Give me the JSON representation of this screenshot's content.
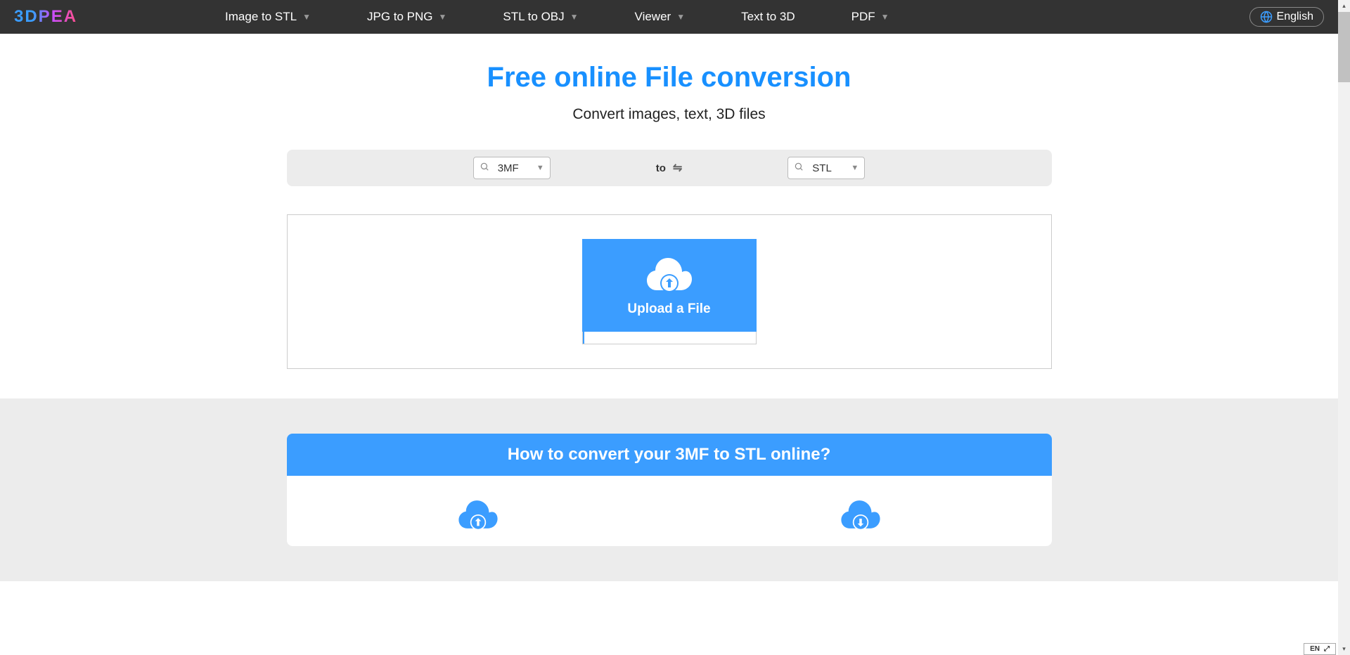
{
  "logo": "3DPEA",
  "nav": [
    {
      "label": "Image to STL",
      "hasChevron": true
    },
    {
      "label": "JPG to PNG",
      "hasChevron": true
    },
    {
      "label": "STL to OBJ",
      "hasChevron": true
    },
    {
      "label": "Viewer",
      "hasChevron": true
    },
    {
      "label": "Text to 3D",
      "hasChevron": false
    },
    {
      "label": "PDF",
      "hasChevron": true
    }
  ],
  "language": "English",
  "hero": {
    "title": "Free online File conversion",
    "subtitle": "Convert images, text, 3D files"
  },
  "converter": {
    "from": "3MF",
    "to_label": "to",
    "to": "STL"
  },
  "upload": {
    "button": "Upload a File"
  },
  "howto": {
    "title": "How to convert your 3MF to STL online?"
  },
  "badge": "EN"
}
